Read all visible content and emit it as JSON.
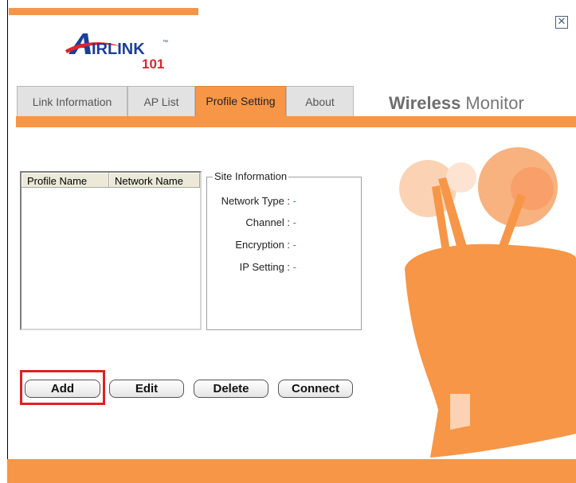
{
  "logo": {
    "text_main": "IRLINK",
    "text_sub": "101",
    "tm": "™"
  },
  "tabs": [
    {
      "label": "Link Information",
      "active": false
    },
    {
      "label": "AP List",
      "active": false
    },
    {
      "label": "Profile Setting",
      "active": true
    },
    {
      "label": "About",
      "active": false
    }
  ],
  "title": {
    "bold": "Wireless",
    "normal": " Monitor"
  },
  "profile_list": {
    "columns": [
      "Profile Name",
      "Network Name"
    ],
    "rows": []
  },
  "site_info": {
    "legend": "Site Information",
    "network_type": {
      "label": "Network Type :",
      "value": "-"
    },
    "channel": {
      "label": "Channel :",
      "value": "-"
    },
    "encryption": {
      "label": "Encryption :",
      "value": "-"
    },
    "ip_setting": {
      "label": "IP Setting :",
      "value": "-"
    }
  },
  "buttons": {
    "add": "Add",
    "edit": "Edit",
    "delete": "Delete",
    "connect": "Connect"
  },
  "colors": {
    "accent": "#f79646",
    "highlight": "#e02020"
  },
  "icons": {
    "close": "close-icon"
  }
}
